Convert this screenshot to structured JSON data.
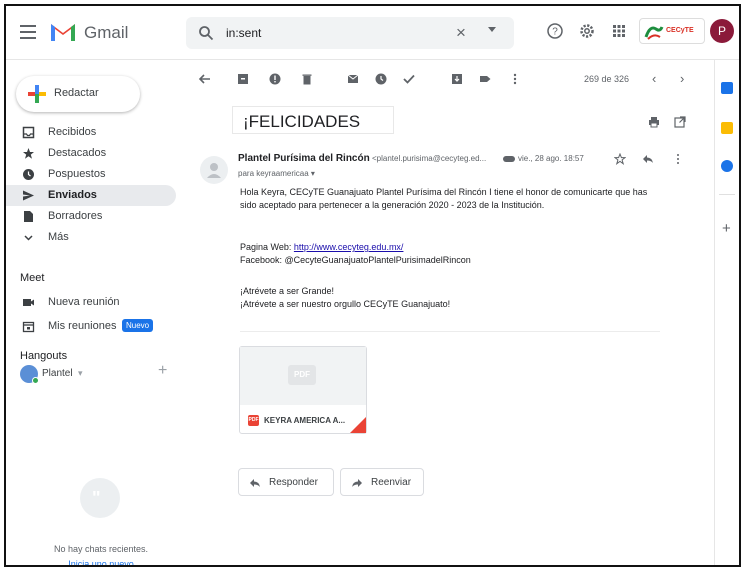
{
  "app": {
    "brand": "Gmail"
  },
  "search": {
    "value": "in:sent"
  },
  "org_logo_text": "CECyTE",
  "account": {
    "initial": "P"
  },
  "compose": {
    "label": "Redactar"
  },
  "nav": [
    {
      "label": "Recibidos",
      "icon": "inbox-icon",
      "active": false
    },
    {
      "label": "Destacados",
      "icon": "star-icon",
      "active": false
    },
    {
      "label": "Pospuestos",
      "icon": "clock-icon",
      "active": false
    },
    {
      "label": "Enviados",
      "icon": "send-icon",
      "active": true
    },
    {
      "label": "Borradores",
      "icon": "draft-icon",
      "active": false
    },
    {
      "label": "Más",
      "icon": "chevron-down-icon",
      "active": false
    }
  ],
  "meet": {
    "title": "Meet",
    "new_meeting": "Nueva reunión",
    "my_meetings": "Mis reuniones",
    "badge": "Nuevo"
  },
  "hangouts": {
    "title": "Hangouts",
    "user": "Plantel",
    "no_chats": "No hay chats recientes.",
    "start_new": "Inicia uno nuevo"
  },
  "toolbar": {
    "count": "269 de 326"
  },
  "message": {
    "subject": "¡FELICIDADES",
    "sender_name": "Plantel Purísima del Rincón",
    "sender_email": "<plantel.purisima@cecyteg.ed...",
    "date": "vie., 28 ago. 18:57",
    "to": "para keyraamericaa",
    "body_1": "Hola Keyra, CECyTE Guanajuato Plantel Purísima del Rincón I tiene el honor de comunicarte que has",
    "body_2": "sido aceptado para pertenecer a la generación 2020 - 2023 de la Institución.",
    "web_label": "Pagina Web:",
    "web_url": "http://www.cecyteg.edu.mx/",
    "facebook": "Facebook: @CecyteGuanajuatoPlantelPurisimadelRincon",
    "closing_1": "¡Atrévete a ser Grande!",
    "closing_2": "¡Atrévete a ser nuestro orgullo CECyTE Guanajuato!"
  },
  "attachment": {
    "thumb_label": "PDF",
    "badge": "PDF",
    "name": "KEYRA AMERICA A..."
  },
  "actions": {
    "reply": "Responder",
    "forward": "Reenviar"
  },
  "colors": {
    "compose_red": "#ea4335",
    "link": "#1a0dab",
    "badge_blue": "#1a73e8",
    "avatar": "#8b1a3a"
  }
}
